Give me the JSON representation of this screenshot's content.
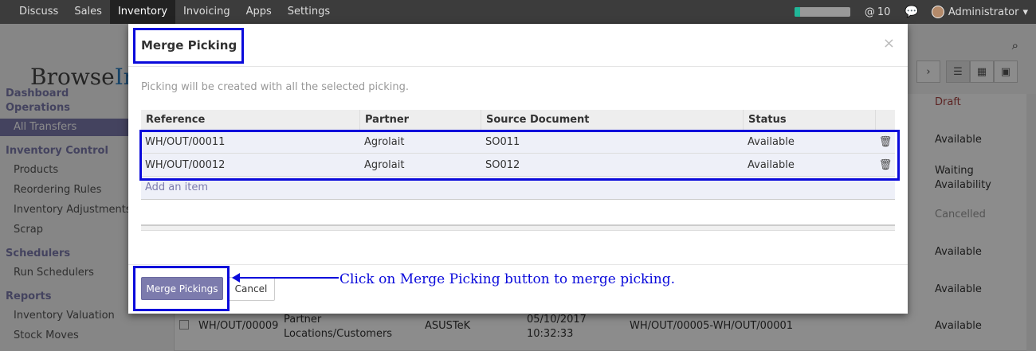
{
  "topbar": {
    "menu": [
      "Discuss",
      "Sales",
      "Inventory",
      "Invoicing",
      "Apps",
      "Settings"
    ],
    "active_menu": "Inventory",
    "progress": 0.1,
    "messages_count": "10",
    "user": "Administrator"
  },
  "page": {
    "logo_prefix": "Browse",
    "logo_suffix": "Inf",
    "sidebar": {
      "sections": [
        {
          "label": "Dashboard",
          "items": []
        },
        {
          "label": "Operations",
          "items": [
            "All Transfers"
          ]
        },
        {
          "label": "Inventory Control",
          "items": [
            "Products",
            "Reordering Rules",
            "Inventory Adjustments",
            "Scrap"
          ]
        },
        {
          "label": "Schedulers",
          "items": [
            "Run Schedulers"
          ]
        },
        {
          "label": "Reports",
          "items": [
            "Inventory Valuation",
            "Stock Moves"
          ]
        }
      ],
      "active_item": "All Transfers"
    },
    "list_statuses": [
      "Draft",
      "Available",
      "Waiting Availability",
      "Cancelled",
      "Available",
      "Available",
      "Available"
    ],
    "visible_row": {
      "reference": "WH/OUT/00009",
      "location": "Partner Locations/Customers",
      "partner": "ASUSTeK",
      "date": "05/10/2017 10:32:33",
      "source": "WH/OUT/00005-WH/OUT/00001",
      "status": "Available"
    }
  },
  "modal": {
    "title": "Merge Picking",
    "help_text": "Picking will be created with all the selected picking.",
    "columns": [
      "Reference",
      "Partner",
      "Source Document",
      "Status"
    ],
    "rows": [
      {
        "reference": "WH/OUT/00011",
        "partner": "Agrolait",
        "source": "SO011",
        "status": "Available"
      },
      {
        "reference": "WH/OUT/00012",
        "partner": "Agrolait",
        "source": "SO012",
        "status": "Available"
      }
    ],
    "add_item": "Add an item",
    "primary_button": "Merge Pickings",
    "cancel_button": "Cancel",
    "close": "×"
  },
  "annotation": "Click on Merge Picking button to merge picking.",
  "colors": {
    "accent": "#7c7bad",
    "highlight": "#0a0adb",
    "topbar": "#3c3c3c"
  }
}
